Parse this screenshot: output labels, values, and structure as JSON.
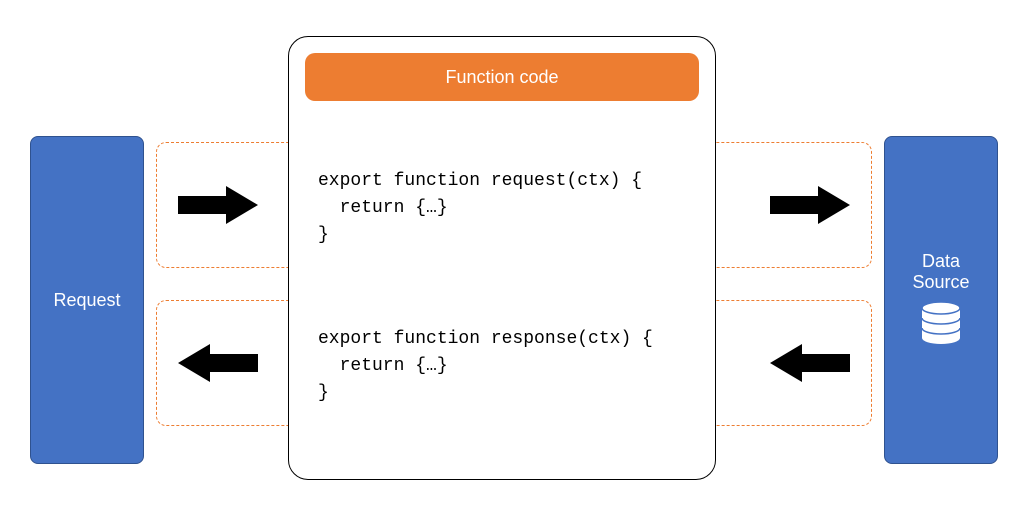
{
  "left_box": {
    "label": "Request"
  },
  "right_box": {
    "label_line1": "Data",
    "label_line2": "Source"
  },
  "center_box": {
    "header": "Function code"
  },
  "code": {
    "request": "export function request(ctx) {\n  return {…}\n}",
    "response": "export function response(ctx) {\n  return {…}\n}"
  },
  "icons": {
    "database": "database-icon",
    "arrow_right": "arrow-right-icon",
    "arrow_left": "arrow-left-icon"
  },
  "colors": {
    "blue": "#4472C4",
    "orange": "#ED7D31",
    "black": "#000000"
  }
}
